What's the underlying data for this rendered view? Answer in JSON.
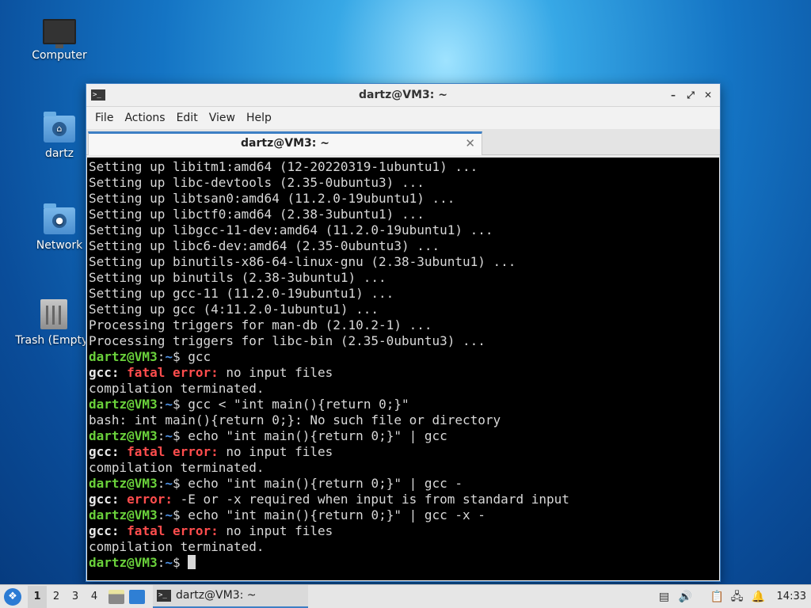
{
  "desktop": {
    "icons": [
      {
        "label": "Computer"
      },
      {
        "label": "dartz"
      },
      {
        "label": "Network"
      },
      {
        "label": "Trash (Empty)"
      }
    ]
  },
  "window": {
    "title": "dartz@VM3: ~",
    "menu": [
      "File",
      "Actions",
      "Edit",
      "View",
      "Help"
    ],
    "tab": {
      "label": "dartz@VM3: ~"
    }
  },
  "terminal": {
    "prompt": {
      "user": "dartz@VM3",
      "path": "~",
      "symbol": "$"
    },
    "lines": [
      {
        "type": "out",
        "text": "Setting up libitm1:amd64 (12-20220319-1ubuntu1) ..."
      },
      {
        "type": "out",
        "text": "Setting up libc-devtools (2.35-0ubuntu3) ..."
      },
      {
        "type": "out",
        "text": "Setting up libtsan0:amd64 (11.2.0-19ubuntu1) ..."
      },
      {
        "type": "out",
        "text": "Setting up libctf0:amd64 (2.38-3ubuntu1) ..."
      },
      {
        "type": "out",
        "text": "Setting up libgcc-11-dev:amd64 (11.2.0-19ubuntu1) ..."
      },
      {
        "type": "out",
        "text": "Setting up libc6-dev:amd64 (2.35-0ubuntu3) ..."
      },
      {
        "type": "out",
        "text": "Setting up binutils-x86-64-linux-gnu (2.38-3ubuntu1) ..."
      },
      {
        "type": "out",
        "text": "Setting up binutils (2.38-3ubuntu1) ..."
      },
      {
        "type": "out",
        "text": "Setting up gcc-11 (11.2.0-19ubuntu1) ..."
      },
      {
        "type": "out",
        "text": "Setting up gcc (4:11.2.0-1ubuntu1) ..."
      },
      {
        "type": "out",
        "text": "Processing triggers for man-db (2.10.2-1) ..."
      },
      {
        "type": "out",
        "text": "Processing triggers for libc-bin (2.35-0ubuntu3) ..."
      },
      {
        "type": "cmd",
        "text": " gcc"
      },
      {
        "type": "err",
        "prefix": "gcc:",
        "err": "fatal error:",
        "text": " no input files"
      },
      {
        "type": "out",
        "text": "compilation terminated."
      },
      {
        "type": "cmd",
        "text": " gcc < \"int main(){return 0;}\""
      },
      {
        "type": "out",
        "text": "bash: int main(){return 0;}: No such file or directory"
      },
      {
        "type": "cmd",
        "text": " echo \"int main(){return 0;}\" | gcc"
      },
      {
        "type": "err",
        "prefix": "gcc:",
        "err": "fatal error:",
        "text": " no input files"
      },
      {
        "type": "out",
        "text": "compilation terminated."
      },
      {
        "type": "cmd",
        "text": " echo \"int main(){return 0;}\" | gcc -"
      },
      {
        "type": "err",
        "prefix": "gcc:",
        "err": "error:",
        "text": " -E or -x required when input is from standard input"
      },
      {
        "type": "cmd",
        "text": " echo \"int main(){return 0;}\" | gcc -x -"
      },
      {
        "type": "err",
        "prefix": "gcc:",
        "err": "fatal error:",
        "text": " no input files"
      },
      {
        "type": "out",
        "text": "compilation terminated."
      },
      {
        "type": "cmd",
        "text": " ",
        "cursor": true
      }
    ]
  },
  "taskbar": {
    "workspaces": [
      "1",
      "2",
      "3",
      "4"
    ],
    "active_workspace": "1",
    "task_label": "dartz@VM3: ~",
    "clock": "14:33"
  },
  "colors": {
    "prompt_user": "#6ad13b",
    "prompt_path": "#4d8fe0",
    "error_red": "#ff4d4d",
    "accent": "#3d7fc4"
  },
  "icons": [
    "computer-icon",
    "home-folder-icon",
    "network-folder-icon",
    "trash-icon",
    "terminal-icon",
    "whisker-menu-icon",
    "volume-icon",
    "network-icon"
  ]
}
